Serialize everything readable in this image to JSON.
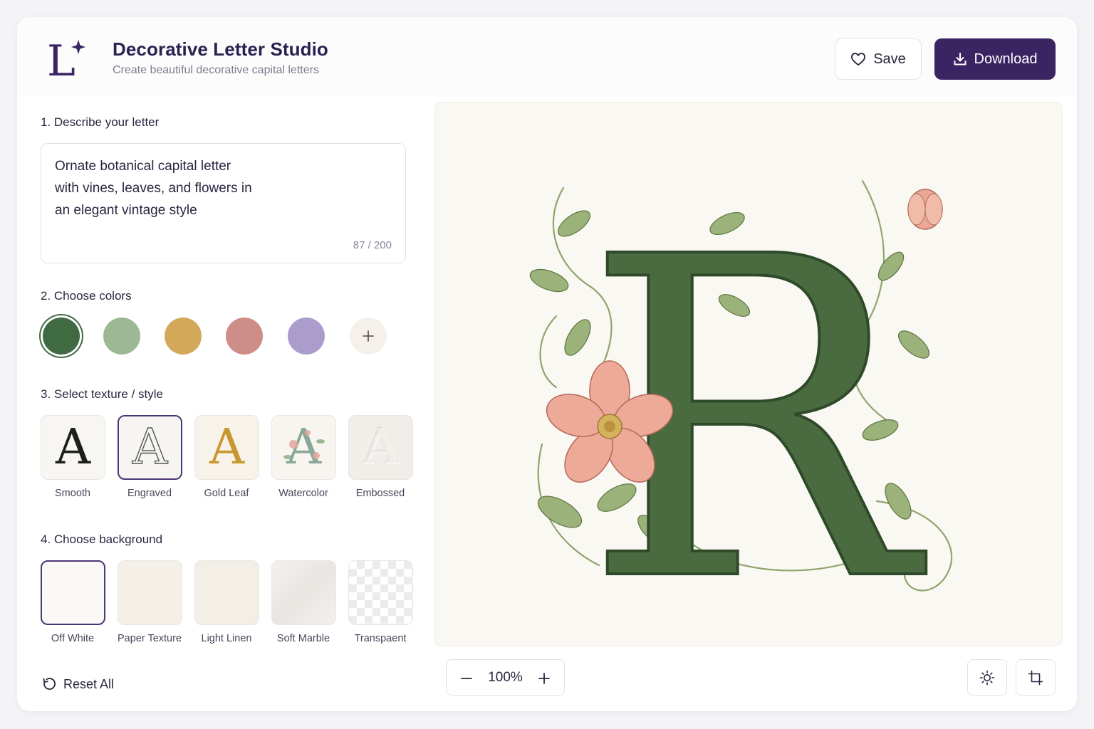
{
  "header": {
    "title": "Decorative Letter Studio",
    "subtitle": "Create beautiful decorative capital letters",
    "logo_text": "L",
    "save_label": "Save",
    "download_label": "Download"
  },
  "step1": {
    "label": "1. Describe your letter",
    "prompt": "Ornate botanical capital letter\nwith vines, leaves, and flowers in\nan elegant vintage style",
    "char_count": "87 / 200"
  },
  "step2": {
    "label": "2. Choose colors",
    "swatches": [
      {
        "name": "forest-green",
        "color": "#3f6a42",
        "selected": true
      },
      {
        "name": "sage",
        "color": "#9cb895",
        "selected": false
      },
      {
        "name": "mustard",
        "color": "#d3a85a",
        "selected": false
      },
      {
        "name": "dusty-rose",
        "color": "#cd8e87",
        "selected": false
      },
      {
        "name": "lavender",
        "color": "#ab9dcb",
        "selected": false
      }
    ],
    "add_icon": "plus-icon"
  },
  "step3": {
    "label": "3. Select texture / style",
    "sample_letter": "A",
    "options": [
      {
        "label": "Smooth",
        "selected": false
      },
      {
        "label": "Engraved",
        "selected": true
      },
      {
        "label": "Gold Leaf",
        "selected": false
      },
      {
        "label": "Watercolor",
        "selected": false
      },
      {
        "label": "Embossed",
        "selected": false
      }
    ]
  },
  "step4": {
    "label": "4. Choose background",
    "options": [
      {
        "label": "Off White",
        "selected": true
      },
      {
        "label": "Paper Texture",
        "selected": false
      },
      {
        "label": "Light Linen",
        "selected": false
      },
      {
        "label": "Soft Marble",
        "selected": false
      },
      {
        "label": "Transpaent",
        "selected": false
      }
    ]
  },
  "reset_label": "Reset All",
  "preview": {
    "letter": "R",
    "zoom": "100%"
  },
  "colors": {
    "brand": "#3a2461",
    "letter_green": "#4a6b3f",
    "flower_pink": "#e9a795"
  }
}
